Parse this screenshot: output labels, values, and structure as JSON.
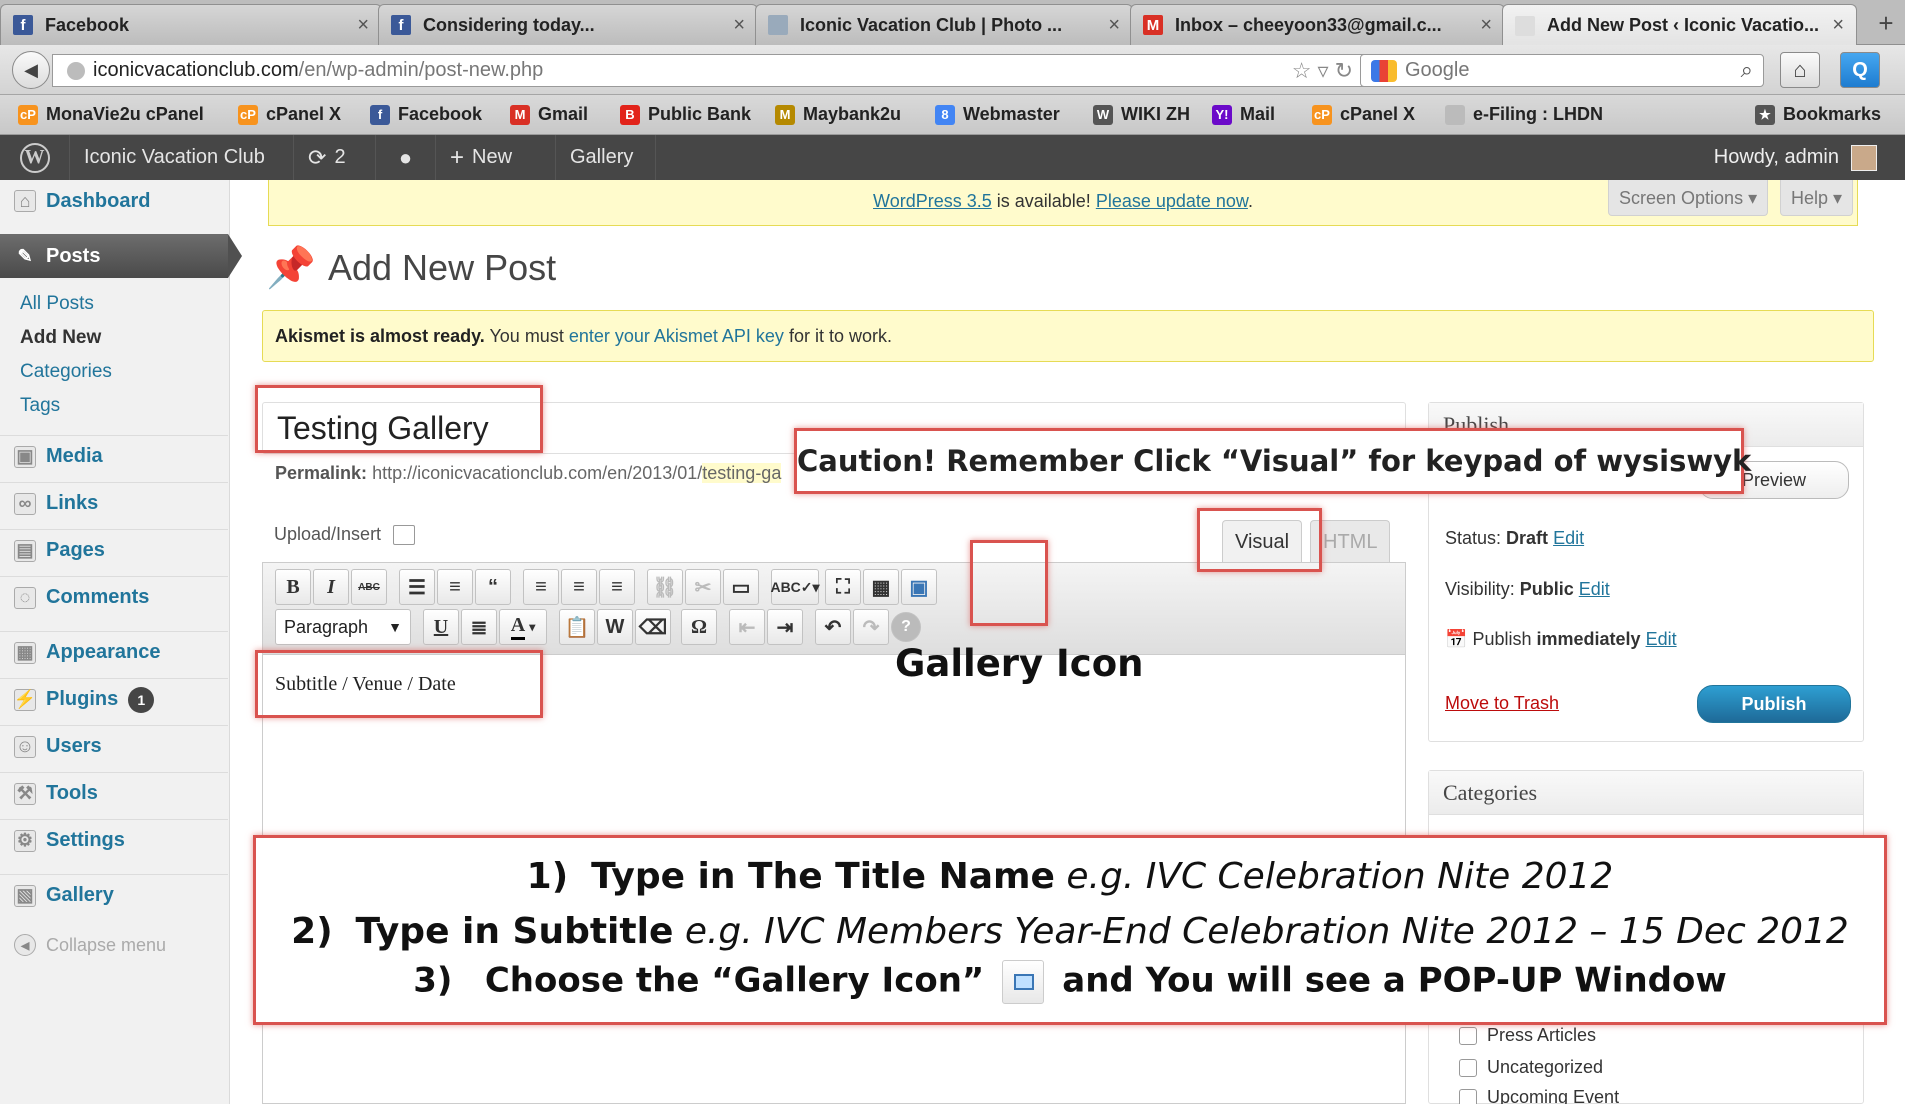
{
  "browser": {
    "tabs": [
      {
        "title": "Facebook",
        "icon": "facebook-icon",
        "color": "#3b5998",
        "glyph": "f"
      },
      {
        "title": "Considering today...",
        "icon": "facebook-icon",
        "color": "#3b5998",
        "glyph": "f"
      },
      {
        "title": "Iconic Vacation Club | Photo ...",
        "icon": "page-icon",
        "color": "#9ab",
        "glyph": ""
      },
      {
        "title": "Inbox – cheeyoon33@gmail.c...",
        "icon": "gmail-icon",
        "color": "#d93025",
        "glyph": "M"
      },
      {
        "title": "Add New Post ‹ Iconic Vacatio...",
        "icon": "blank-page-icon",
        "color": "#ddd",
        "glyph": ""
      }
    ],
    "close_glyph": "×",
    "new_tab_glyph": "+",
    "url_domain": "iconicvacationclub.com",
    "url_path": "/en/wp-admin/post-new.php",
    "search_placeholder": "Google",
    "bookmarks": [
      {
        "label": "MonaVie2u cPanel",
        "icon": "cpanel-icon",
        "color": "#f7931e",
        "glyph": "cP"
      },
      {
        "label": "cPanel X",
        "icon": "cpanel-icon",
        "color": "#f7931e",
        "glyph": "cP"
      },
      {
        "label": "Facebook",
        "icon": "facebook-icon",
        "color": "#3b5998",
        "glyph": "f"
      },
      {
        "label": "Gmail",
        "icon": "gmail-icon",
        "color": "#d93025",
        "glyph": "M"
      },
      {
        "label": "Public Bank",
        "icon": "bank-icon",
        "color": "#e2231a",
        "glyph": "B"
      },
      {
        "label": "Maybank2u",
        "icon": "maybank-icon",
        "color": "#b58900",
        "glyph": "M"
      },
      {
        "label": "Webmaster",
        "icon": "webmaster-icon",
        "color": "#4285f4",
        "glyph": "8"
      },
      {
        "label": "WIKI ZH",
        "icon": "wikipedia-icon",
        "color": "#555",
        "glyph": "W"
      },
      {
        "label": "Mail",
        "icon": "yahoo-mail-icon",
        "color": "#6b0ac9",
        "glyph": "Y!"
      },
      {
        "label": "cPanel X",
        "icon": "cpanel-icon",
        "color": "#f7931e",
        "glyph": "cP"
      },
      {
        "label": "e-Filing : LHDN",
        "icon": "page-icon",
        "color": "#bbb",
        "glyph": ""
      }
    ],
    "bookmarks_menu": "Bookmarks"
  },
  "adminbar": {
    "site": "Iconic Vacation Club",
    "updates": "2",
    "new": "New",
    "gallery": "Gallery",
    "howdy": "Howdy, admin"
  },
  "sidebar": {
    "dashboard": "Dashboard",
    "posts": "Posts",
    "posts_sub": [
      "All Posts",
      "Add New",
      "Categories",
      "Tags"
    ],
    "media": "Media",
    "links": "Links",
    "pages": "Pages",
    "comments": "Comments",
    "appearance": "Appearance",
    "plugins": "Plugins",
    "plugins_badge": "1",
    "users": "Users",
    "tools": "Tools",
    "settings": "Settings",
    "gallery": "Gallery",
    "collapse": "Collapse menu"
  },
  "notice": {
    "update_link": "WordPress 3.5",
    "update_text": " is available! ",
    "update_now": "Please update now",
    "update_end": ".",
    "screen_options": "Screen Options",
    "help": "Help",
    "akismet_bold": "Akismet is almost ready.",
    "akismet_text": " You must ",
    "akismet_link": "enter your Akismet API key",
    "akismet_end": " for it to work."
  },
  "page_title": "Add New Post",
  "post": {
    "title_value": "Testing Gallery",
    "permalink_label": "Permalink:",
    "permalink_url": "http://iconicvacationclub.com/en/2013/01/",
    "permalink_slug": "testing-ga",
    "upload_insert": "Upload/Insert",
    "tab_visual": "Visual",
    "tab_html": "HTML",
    "format_select": "Paragraph",
    "body_text": "Subtitle / Venue / Date"
  },
  "publish": {
    "heading": "Publish",
    "preview": "Preview",
    "status_label": "Status:",
    "status_value": "Draft",
    "visibility_label": "Visibility:",
    "visibility_value": "Public",
    "publish_label": "Publish",
    "publish_value": "immediately",
    "edit": "Edit",
    "move_to_trash": "Move to Trash",
    "publish_button": "Publish"
  },
  "categories": {
    "heading": "Categories",
    "items": [
      "Press Articles",
      "Uncategorized",
      "Upcoming Event"
    ]
  },
  "annotations": {
    "caution": "Caution! Remember Click “Visual” for keypad of wysiswyk",
    "gallery_icon_label": "Gallery Icon",
    "step1_num": "1)",
    "step1_bold": "Type in The Title Name",
    "step1_italic": "e.g. IVC Celebration Nite 2012",
    "step2_num": "2)",
    "step2_bold": "Type in Subtitle",
    "step2_italic": "e.g. IVC Members Year-End Celebration Nite 2012 – 15 Dec 2012",
    "step3_num": "3)",
    "step3_bold1": "Choose the “Gallery Icon”",
    "step3_bold2": "and You will see a POP-UP Window"
  },
  "colors": {
    "wp_link": "#21759b",
    "annotation_red": "#d9534f",
    "admin_bar": "#464646",
    "publish_blue": "#21759b"
  }
}
